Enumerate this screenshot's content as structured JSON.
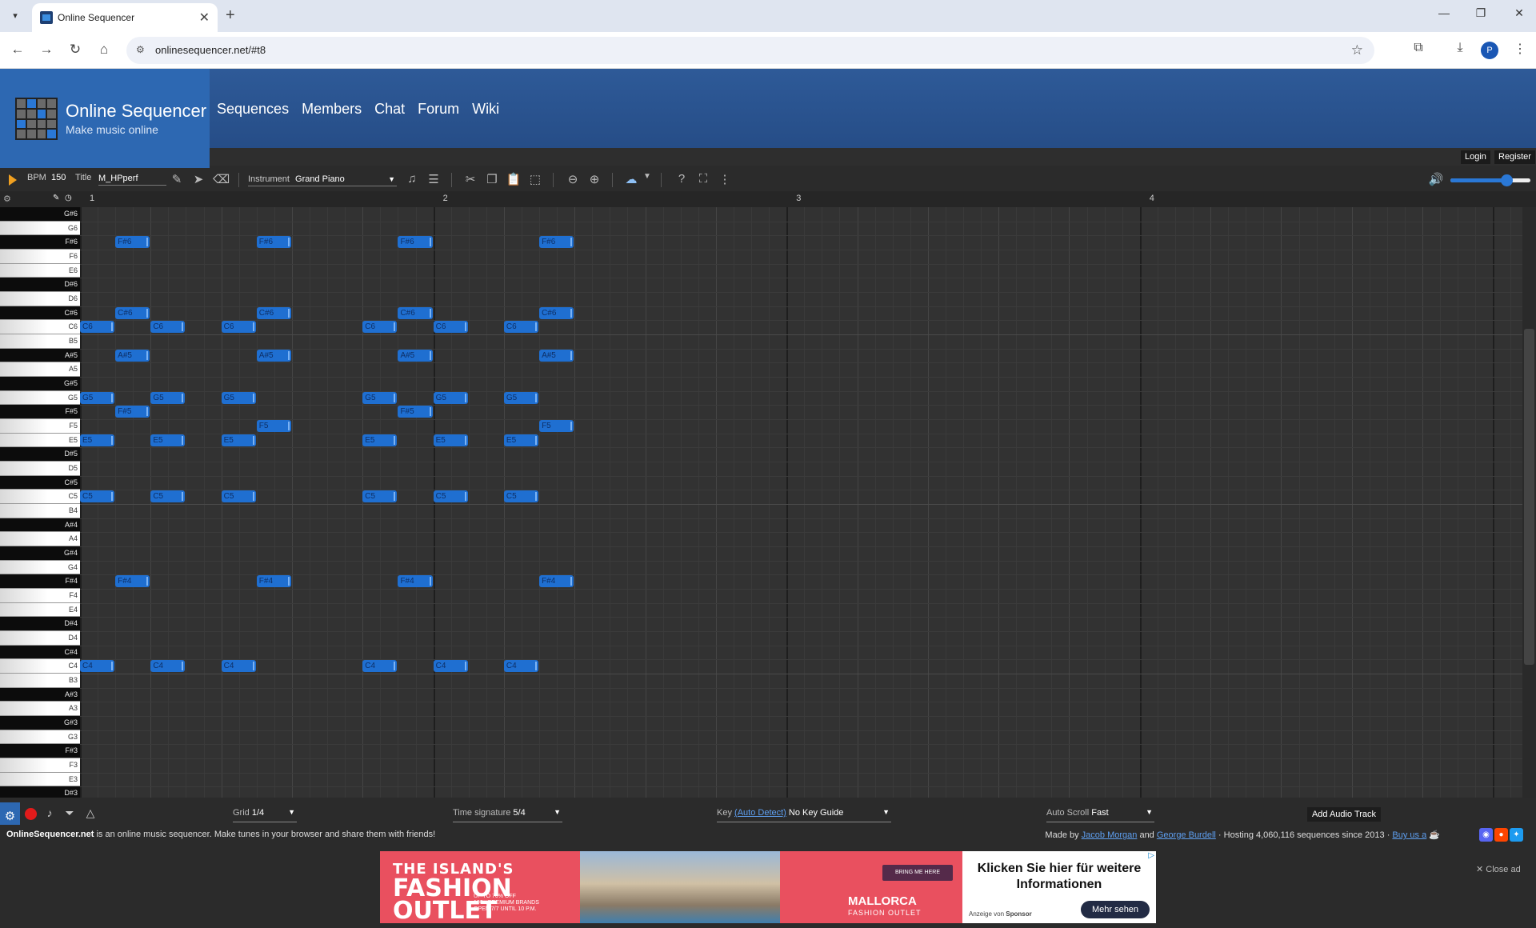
{
  "browser": {
    "tab_title": "Online Sequencer",
    "url": "onlinesequencer.net/#t8",
    "profile_initial": "P"
  },
  "site": {
    "brand_name": "Online Sequencer",
    "brand_tagline": "Make music online",
    "nav": [
      "Sequences",
      "Members",
      "Chat",
      "Forum",
      "Wiki"
    ],
    "login": "Login",
    "register": "Register"
  },
  "editor": {
    "bpm_label": "BPM",
    "bpm_value": "150",
    "title_label": "Title",
    "title_value": "M_HPperf",
    "instrument_label": "Instrument",
    "instrument_value": "Grand Piano",
    "volume": 0.7
  },
  "roll": {
    "bar_labels": [
      "1",
      "2",
      "3",
      "4"
    ],
    "keys": [
      {
        "n": "G#6",
        "b": true
      },
      {
        "n": "G6",
        "b": false
      },
      {
        "n": "F#6",
        "b": true
      },
      {
        "n": "F6",
        "b": false
      },
      {
        "n": "E6",
        "b": false
      },
      {
        "n": "D#6",
        "b": true
      },
      {
        "n": "D6",
        "b": false
      },
      {
        "n": "C#6",
        "b": true
      },
      {
        "n": "C6",
        "b": false
      },
      {
        "n": "B5",
        "b": false
      },
      {
        "n": "A#5",
        "b": true
      },
      {
        "n": "A5",
        "b": false
      },
      {
        "n": "G#5",
        "b": true
      },
      {
        "n": "G5",
        "b": false
      },
      {
        "n": "F#5",
        "b": true
      },
      {
        "n": "F5",
        "b": false
      },
      {
        "n": "E5",
        "b": false
      },
      {
        "n": "D#5",
        "b": true
      },
      {
        "n": "D5",
        "b": false
      },
      {
        "n": "C#5",
        "b": true
      },
      {
        "n": "C5",
        "b": false
      },
      {
        "n": "B4",
        "b": false
      },
      {
        "n": "A#4",
        "b": true
      },
      {
        "n": "A4",
        "b": false
      },
      {
        "n": "G#4",
        "b": true
      },
      {
        "n": "G4",
        "b": false
      },
      {
        "n": "F#4",
        "b": true
      },
      {
        "n": "F4",
        "b": false
      },
      {
        "n": "E4",
        "b": false
      },
      {
        "n": "D#4",
        "b": true
      },
      {
        "n": "D4",
        "b": false
      },
      {
        "n": "C#4",
        "b": true
      },
      {
        "n": "C4",
        "b": false
      },
      {
        "n": "B3",
        "b": false
      },
      {
        "n": "A#3",
        "b": true
      },
      {
        "n": "A3",
        "b": false
      },
      {
        "n": "G#3",
        "b": true
      },
      {
        "n": "G3",
        "b": false
      },
      {
        "n": "F#3",
        "b": true
      },
      {
        "n": "F3",
        "b": false
      },
      {
        "n": "E3",
        "b": false
      },
      {
        "n": "D#3",
        "b": true
      }
    ],
    "notes": [
      {
        "p": "C6",
        "t": 0
      },
      {
        "p": "G5",
        "t": 0
      },
      {
        "p": "E5",
        "t": 0
      },
      {
        "p": "C5",
        "t": 0
      },
      {
        "p": "C4",
        "t": 0
      },
      {
        "p": "F#6",
        "t": 2
      },
      {
        "p": "C#6",
        "t": 2
      },
      {
        "p": "A#5",
        "t": 2
      },
      {
        "p": "F#5",
        "t": 2
      },
      {
        "p": "F#4",
        "t": 2
      },
      {
        "p": "C6",
        "t": 4
      },
      {
        "p": "G5",
        "t": 4
      },
      {
        "p": "E5",
        "t": 4
      },
      {
        "p": "C5",
        "t": 4
      },
      {
        "p": "C4",
        "t": 4
      },
      {
        "p": "C6",
        "t": 8
      },
      {
        "p": "G5",
        "t": 8
      },
      {
        "p": "E5",
        "t": 8
      },
      {
        "p": "C5",
        "t": 8
      },
      {
        "p": "C4",
        "t": 8
      },
      {
        "p": "F#6",
        "t": 10
      },
      {
        "p": "C#6",
        "t": 10
      },
      {
        "p": "A#5",
        "t": 10
      },
      {
        "p": "F5",
        "t": 10
      },
      {
        "p": "F#4",
        "t": 10
      },
      {
        "p": "C6",
        "t": 16
      },
      {
        "p": "G5",
        "t": 16
      },
      {
        "p": "E5",
        "t": 16
      },
      {
        "p": "C5",
        "t": 16
      },
      {
        "p": "C4",
        "t": 16
      },
      {
        "p": "F#6",
        "t": 18
      },
      {
        "p": "C#6",
        "t": 18
      },
      {
        "p": "A#5",
        "t": 18
      },
      {
        "p": "F#5",
        "t": 18
      },
      {
        "p": "F#4",
        "t": 18
      },
      {
        "p": "C6",
        "t": 20
      },
      {
        "p": "G5",
        "t": 20
      },
      {
        "p": "E5",
        "t": 20
      },
      {
        "p": "C5",
        "t": 20
      },
      {
        "p": "C4",
        "t": 20
      },
      {
        "p": "C6",
        "t": 24
      },
      {
        "p": "G5",
        "t": 24
      },
      {
        "p": "E5",
        "t": 24
      },
      {
        "p": "C5",
        "t": 24
      },
      {
        "p": "C4",
        "t": 24
      },
      {
        "p": "F#6",
        "t": 26
      },
      {
        "p": "C#6",
        "t": 26
      },
      {
        "p": "A#5",
        "t": 26
      },
      {
        "p": "F5",
        "t": 26
      },
      {
        "p": "F#4",
        "t": 26
      }
    ]
  },
  "footer": {
    "grid_label": "Grid",
    "grid_value": "1/4",
    "time_sig_label": "Time signature",
    "time_sig_value": "5/4",
    "key_label": "Key",
    "key_auto_detect": "(Auto Detect)",
    "key_value": "No Key Guide",
    "autoscroll_label": "Auto Scroll",
    "autoscroll_value": "Fast",
    "add_audio_track": "Add Audio Track"
  },
  "info": {
    "site_bold": "OnlineSequencer.net",
    "site_text": " is an online music sequencer. Make tunes in your browser and share them with friends!",
    "made_by": "Made by ",
    "author1": "Jacob Morgan",
    "and": " and ",
    "author2": "George Burdell",
    "hosting": " · Hosting 4,060,116 sequences since 2013 · ",
    "buy": "Buy us a"
  },
  "ad": {
    "line1": "THE ISLAND'S",
    "line2": "FASHION",
    "line3": "OUTLET",
    "small1": "UP TO 70% OFF",
    "small2": "100+ PREMIUM BRANDS",
    "small3": "OPEN 7/7 UNTIL 10 P.M.",
    "cta_small": "BRING ME HERE",
    "brand": "MALLORCA",
    "brand_sub": "FASHION OUTLET",
    "headline": "Klicken Sie hier für weitere Informationen",
    "label": "Anzeige von",
    "sponsor": "Sponsor",
    "button": "Mehr sehen",
    "close": "✕ Close ad"
  }
}
